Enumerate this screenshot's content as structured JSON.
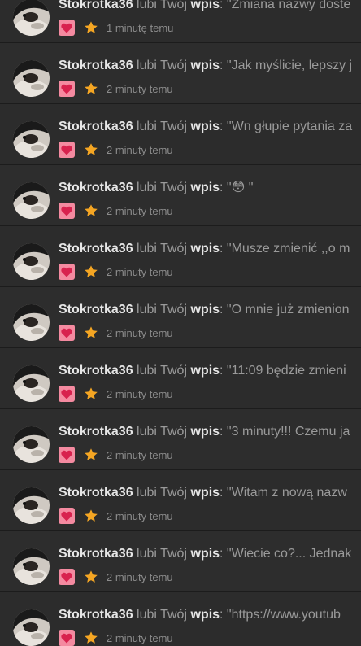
{
  "feed": {
    "connector": "lubi Twój",
    "target_word": "wpis",
    "items": [
      {
        "user": "Stokrotka36",
        "post": "\"Zmiana nazwy doste",
        "time": "1 minutę temu"
      },
      {
        "user": "Stokrotka36",
        "post": "\"Jak myślicie, lepszy j",
        "time": "2 minuty temu"
      },
      {
        "user": "Stokrotka36",
        "post": "\"Wn głupie pytania za",
        "time": "2 minuty temu"
      },
      {
        "user": "Stokrotka36",
        "post": "\"😳 \"",
        "time": "2 minuty temu"
      },
      {
        "user": "Stokrotka36",
        "post": "\"Musze zmienić ,,o m",
        "time": "2 minuty temu"
      },
      {
        "user": "Stokrotka36",
        "post": "\"O mnie już zmienion",
        "time": "2 minuty temu"
      },
      {
        "user": "Stokrotka36",
        "post": "\"11:09 będzie zmieni",
        "time": "2 minuty temu"
      },
      {
        "user": "Stokrotka36",
        "post": "\"3 minuty!!! Czemu ja",
        "time": "2 minuty temu"
      },
      {
        "user": "Stokrotka36",
        "post": "\"Witam z nową nazw",
        "time": "2 minuty temu"
      },
      {
        "user": "Stokrotka36",
        "post": "\"Wiecie co?... Jednak",
        "time": "2 minuty temu"
      },
      {
        "user": "Stokrotka36",
        "post": "\"https://www.youtub",
        "time": "2 minuty temu"
      }
    ],
    "icons": {
      "like_badge": "heart-icon",
      "favorite": "star-icon"
    },
    "colors": {
      "heart_badge_bg": "#f48aa0",
      "heart": "#d8224e",
      "star": "#f5a623",
      "username": "#e6e6e6",
      "muted_text": "#9a9a9a",
      "background": "#2c2c2c"
    }
  }
}
